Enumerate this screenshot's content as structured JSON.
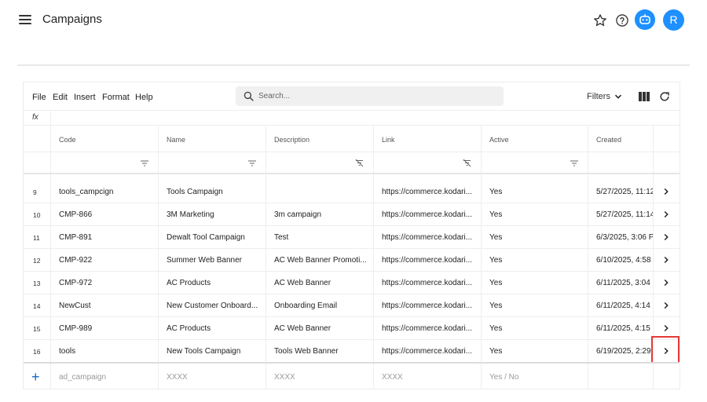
{
  "app": {
    "title": "Campaigns",
    "avatar_letter": "R",
    "accent_color": "#1e90ff"
  },
  "menu": [
    "File",
    "Edit",
    "Insert",
    "Format",
    "Help"
  ],
  "search": {
    "placeholder": "Search..."
  },
  "toolbar": {
    "filters_label": "Filters"
  },
  "formula_bar": {
    "label": "fx"
  },
  "columns": [
    "Code",
    "Name",
    "Description",
    "Link",
    "Active",
    "Created"
  ],
  "rows": [
    {
      "num": "9",
      "code": "tools_campcign",
      "name": "Tools Campaign",
      "description": "",
      "link": "https://commerce.kodari...",
      "active": "Yes",
      "created": "5/27/2025, 11:12"
    },
    {
      "num": "10",
      "code": "CMP-866",
      "name": "3M Marketing",
      "description": "3m campaign",
      "link": "https://commerce.kodari...",
      "active": "Yes",
      "created": "5/27/2025, 11:14"
    },
    {
      "num": "11",
      "code": "CMP-891",
      "name": "Dewalt Tool Campaign",
      "description": "Test",
      "link": "https://commerce.kodari...",
      "active": "Yes",
      "created": "6/3/2025, 3:06 P"
    },
    {
      "num": "12",
      "code": "CMP-922",
      "name": "Summer Web Banner",
      "description": "AC Web Banner Promoti...",
      "link": "https://commerce.kodari...",
      "active": "Yes",
      "created": "6/10/2025, 4:58"
    },
    {
      "num": "13",
      "code": "CMP-972",
      "name": "AC Products",
      "description": "AC Web Banner",
      "link": "https://commerce.kodari...",
      "active": "Yes",
      "created": "6/11/2025, 3:04"
    },
    {
      "num": "14",
      "code": "NewCust",
      "name": "New Customer Onboard...",
      "description": "Onboarding Email",
      "link": "https://commerce.kodari...",
      "active": "Yes",
      "created": "6/11/2025, 4:14"
    },
    {
      "num": "15",
      "code": "CMP-989",
      "name": "AC Products",
      "description": "AC Web Banner",
      "link": "https://commerce.kodari...",
      "active": "Yes",
      "created": "6/11/2025, 4:15"
    },
    {
      "num": "16",
      "code": "tools",
      "name": "New Tools Campaign",
      "description": "Tools Web Banner",
      "link": "https://commerce.kodari...",
      "active": "Yes",
      "created": "6/19/2025, 2:29"
    }
  ],
  "new_row": {
    "plus": "+",
    "code_placeholder": "ad_campaign",
    "name_placeholder": "XXXX",
    "description_placeholder": "XXXX",
    "link_placeholder": "XXXX",
    "active_placeholder": "Yes / No"
  },
  "highlight_color": "#e53935"
}
